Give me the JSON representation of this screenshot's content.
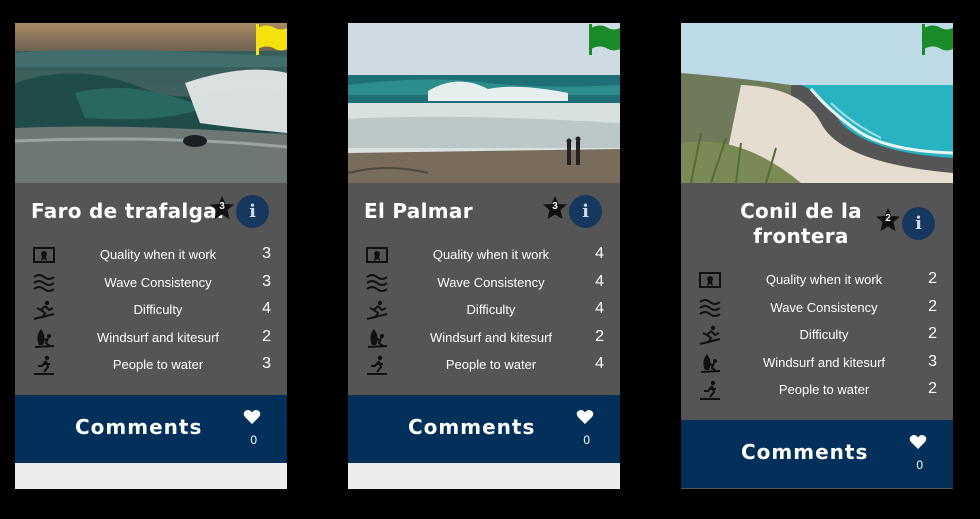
{
  "cards": [
    {
      "title": "Faro de trafalgar",
      "rating": "3",
      "flag_color": "#f4e10e",
      "rows": [
        {
          "label": "Quality when it work",
          "value": "3",
          "icon": "award-icon"
        },
        {
          "label": "Wave Consistency",
          "value": "3",
          "icon": "waves-icon"
        },
        {
          "label": "Difficulty",
          "value": "4",
          "icon": "surfer-icon"
        },
        {
          "label": "Windsurf and kitesurf",
          "value": "2",
          "icon": "windsurf-icon"
        },
        {
          "label": "People to water",
          "value": "3",
          "icon": "people-icon"
        }
      ],
      "comments_label": "Comments",
      "likes": "0"
    },
    {
      "title": "El Palmar",
      "rating": "3",
      "flag_color": "#1a8a2a",
      "rows": [
        {
          "label": "Quality when it work",
          "value": "4",
          "icon": "award-icon"
        },
        {
          "label": "Wave Consistency",
          "value": "4",
          "icon": "waves-icon"
        },
        {
          "label": "Difficulty",
          "value": "4",
          "icon": "surfer-icon"
        },
        {
          "label": "Windsurf and kitesurf",
          "value": "2",
          "icon": "windsurf-icon"
        },
        {
          "label": "People to water",
          "value": "4",
          "icon": "people-icon"
        }
      ],
      "comments_label": "Comments",
      "likes": "0"
    },
    {
      "title": "Conil de la frontera",
      "rating": "2",
      "flag_color": "#1a8a2a",
      "rows": [
        {
          "label": "Quality when it work",
          "value": "2",
          "icon": "award-icon"
        },
        {
          "label": "Wave Consistency",
          "value": "2",
          "icon": "waves-icon"
        },
        {
          "label": "Difficulty",
          "value": "2",
          "icon": "surfer-icon"
        },
        {
          "label": "Windsurf and kitesurf",
          "value": "3",
          "icon": "windsurf-icon"
        },
        {
          "label": "People to water",
          "value": "2",
          "icon": "people-icon"
        }
      ],
      "comments_label": "Comments",
      "likes": "0"
    }
  ]
}
